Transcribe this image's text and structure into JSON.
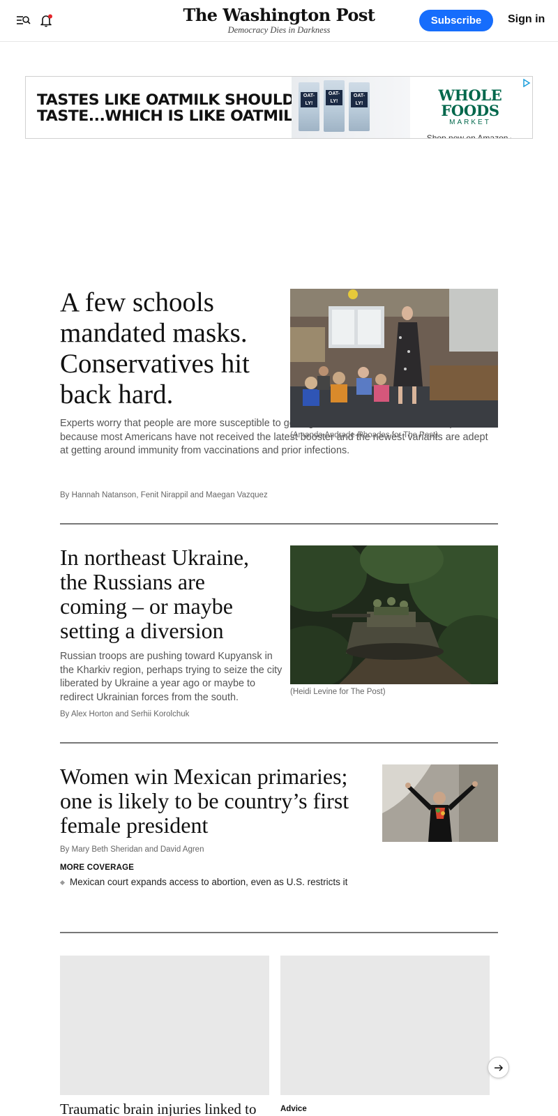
{
  "header": {
    "logo": "The Washington Post",
    "tagline": "Democracy Dies in Darkness",
    "subscribe_label": "Subscribe",
    "signin_label": "Sign in",
    "icons": {
      "menu": "menu-search-icon",
      "alerts": "bell-icon"
    }
  },
  "ad": {
    "headline_line1": "TASTES LIKE OATMILK SHOULD",
    "headline_line2": "TASTE...WHICH IS LIKE OATMILK.",
    "product_label": "OAT-LY!",
    "brand_line1": "WHOLE FOODS",
    "brand_line2": "MARKET",
    "cta": "Shop now on Amazon",
    "cta_arrow": "▸",
    "colors": {
      "brand": "#00674b"
    }
  },
  "stories": [
    {
      "headline": "A few schools mandated masks. Conservatives hit back hard.",
      "blurb": "Experts worry that people are more susceptible to getting the coronavirus in this latest uptick because most Americans have not received the latest booster and the newest variants are adept at getting around immunity from vaccinations and prior infections.",
      "byline": "By Hannah Natanson, Fenit Nirappil and Maegan Vazquez",
      "caption": "(Amanda Andrade-Rhoades for The Post)"
    },
    {
      "headline": "In northeast Ukraine, the Russians are coming – or maybe setting a diversion",
      "blurb": "Russian troops are pushing toward Kupyansk in the Kharkiv region, perhaps trying to seize the city liberated by Ukraine a year ago or maybe to redirect Ukrainian forces from the south.",
      "byline": "By Alex Horton and Serhii Korolchuk",
      "caption": "(Heidi Levine for The Post)"
    },
    {
      "headline": "Women win Mexican primaries; one is likely to be country’s first female president",
      "byline": "By Mary Beth Sheridan and David Agren",
      "more_coverage_label": "MORE COVERAGE",
      "more_coverage_items": [
        "Mexican court expands access to abortion, even as U.S. restricts it"
      ]
    }
  ],
  "carousel": {
    "cards": [
      {
        "headline": "Traumatic brain injuries linked to"
      },
      {
        "kicker": "Advice"
      }
    ],
    "next_icon": "arrow-right-icon"
  },
  "colors": {
    "accent": "#166dfc",
    "divider": "#777777"
  }
}
